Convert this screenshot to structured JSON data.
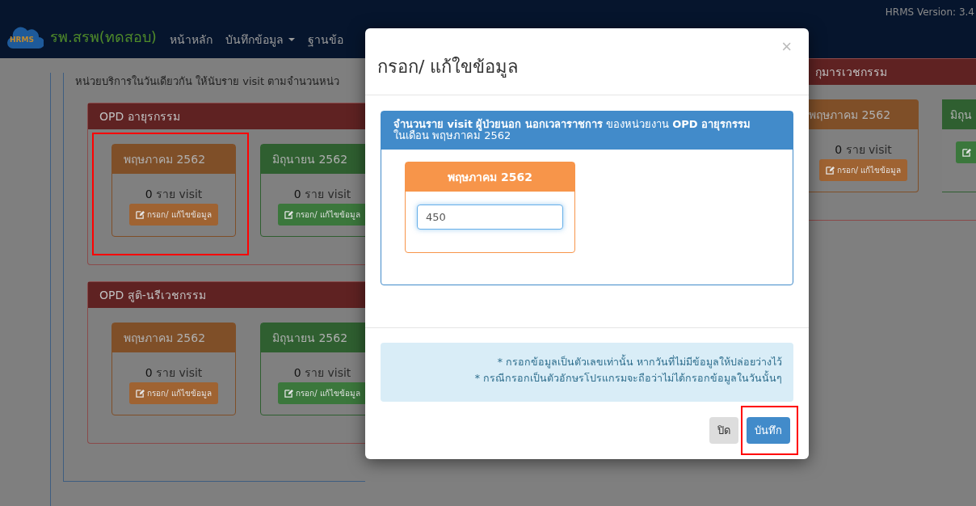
{
  "header": {
    "logo": "HRMS",
    "brand": "รพ.สรพ(ทดสอบ)",
    "nav": [
      {
        "label": "หน้าหลัก",
        "dropdown": false
      },
      {
        "label": "บันทึกข้อมูล",
        "dropdown": true
      },
      {
        "label": "ฐานข้อ",
        "dropdown": false
      }
    ],
    "version": "HRMS Version: 3.4"
  },
  "note": "หน่วยบริการในวันเดียวกัน ให้นับราย visit ตามจำนวนหน่ว",
  "panels": [
    {
      "title": "OPD อายุรกรรม",
      "months": [
        {
          "label": "พฤษภาคม 2562",
          "color": "#7f4f28",
          "count": "0",
          "unit": "ราย visit",
          "button": "กรอก/ แก้ไขข้อมูล",
          "highlighted": true
        },
        {
          "label": "มิถุนายน 2562",
          "color": "#2f5f30",
          "count": "0",
          "unit": "ราย visit",
          "button": "กรอก/ แก้ไขข้อมูล",
          "highlighted": false
        }
      ]
    },
    {
      "title": "OPD สูติ-นรีเวชกรรม",
      "months": [
        {
          "label": "พฤษภาคม 2562",
          "color": "#7f4f28",
          "count": "0",
          "unit": "ราย visit",
          "button": "กรอก/ แก้ไขข้อมูล",
          "highlighted": false
        },
        {
          "label": "มิถุนายน 2562",
          "color": "#2f5f30",
          "count": "0",
          "unit": "ราย visit",
          "button": "กรอก/ แก้ไขข้อมูล",
          "highlighted": false
        }
      ]
    }
  ],
  "right_panel": {
    "title": "กุมารเวชกรรม",
    "months": [
      {
        "label": "พฤษภาคม 2562",
        "color": "#7f4f28",
        "count": "0",
        "unit": "ราย visit",
        "button": "กรอก/ แก้ไขข้อมูล"
      },
      {
        "label": "มิถุน",
        "color": "#2f5f30"
      }
    ]
  },
  "modal": {
    "title": "กรอก/ แก้ใขข้อมูล",
    "close": "×",
    "panel_heading": "**จำนวนราย visit ผู้ป่วยนอก นอกเวลาราชการ** ของหน่วยงาน **OPD อายุรกรรม**\nในเดือน พฤษภาคม 2562",
    "month": "พฤษภาคม 2562",
    "value": "450",
    "notes": [
      "* กรอกข้อมูลเป็นตัวเลขเท่านั้น หากวันที่ไม่มีข้อมูลให้ปล่อยว่างไว้",
      "* กรณีกรอกเป็นตัวอักษรโปรแกรมจะถือว่าไม่ได้กรอกข้อมูลในวันนั้นๆ"
    ],
    "buttons": [
      {
        "label": "ปิด",
        "kind": "default",
        "highlighted": false
      },
      {
        "label": "บันทึก",
        "kind": "primary",
        "highlighted": true
      }
    ]
  }
}
